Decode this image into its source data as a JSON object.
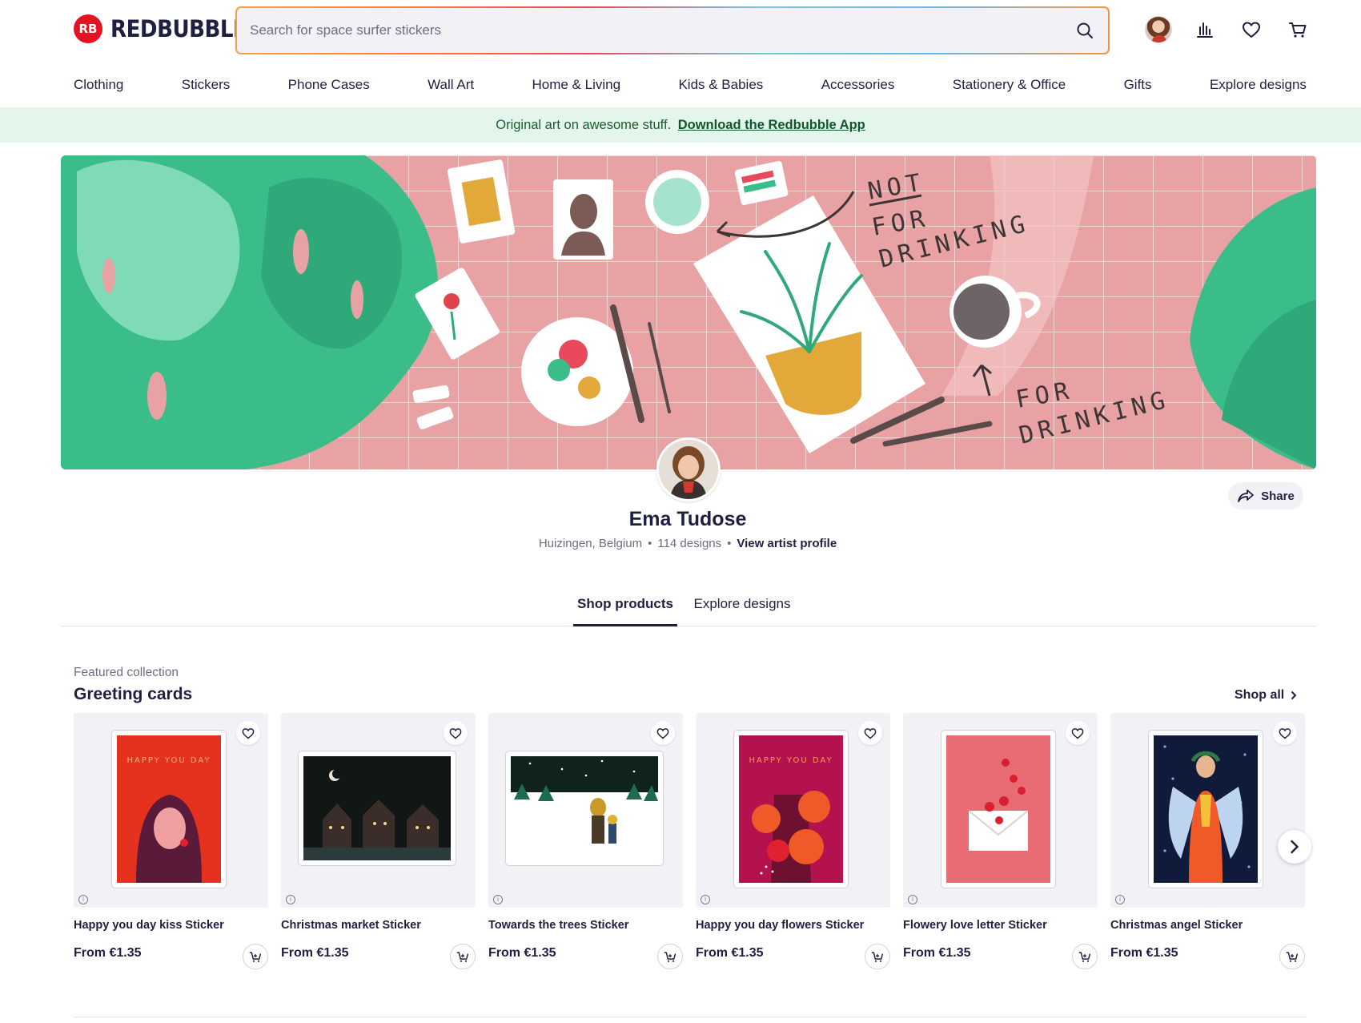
{
  "header": {
    "logo_text": "REDBUBBLE",
    "logo_mark": "RB",
    "search_placeholder": "Search for space surfer stickers",
    "icons": [
      "avatar",
      "bar-chart-icon",
      "heart-icon",
      "cart-icon"
    ]
  },
  "nav": {
    "items": [
      "Clothing",
      "Stickers",
      "Phone Cases",
      "Wall Art",
      "Home & Living",
      "Kids & Babies",
      "Accessories",
      "Stationery & Office",
      "Gifts",
      "Explore designs"
    ]
  },
  "promo": {
    "text": "Original art on awesome stuff.",
    "link": "Download the Redbubble App"
  },
  "banner": {
    "lettering": [
      "NOT",
      "FOR",
      "DRINKING",
      "FOR",
      "DRINKING"
    ]
  },
  "profile": {
    "name": "Ema Tudose",
    "location": "Huizingen, Belgium",
    "designs": "114 designs",
    "view_profile": "View artist profile",
    "share_label": "Share"
  },
  "tabs": {
    "shop": "Shop products",
    "explore": "Explore designs"
  },
  "featured": {
    "label": "Featured collection",
    "title": "Greeting cards",
    "shop_all": "Shop all",
    "products": [
      {
        "title": "Happy you day kiss Sticker",
        "price": "From €1.35",
        "card_text": "HAPPY YOU DAY"
      },
      {
        "title": "Christmas market Sticker",
        "price": "From €1.35"
      },
      {
        "title": "Towards the trees Sticker",
        "price": "From €1.35"
      },
      {
        "title": "Happy you day flowers Sticker",
        "price": "From €1.35",
        "card_text": "HAPPY YOU DAY"
      },
      {
        "title": "Flowery love letter Sticker",
        "price": "From €1.35"
      },
      {
        "title": "Christmas angel Sticker",
        "price": "From €1.35"
      }
    ]
  },
  "colors": {
    "brand_red": "#e41321",
    "text_dark": "#1f2041",
    "promo_bg": "#e4f6ec",
    "banner_pink": "#e9a2a4"
  }
}
